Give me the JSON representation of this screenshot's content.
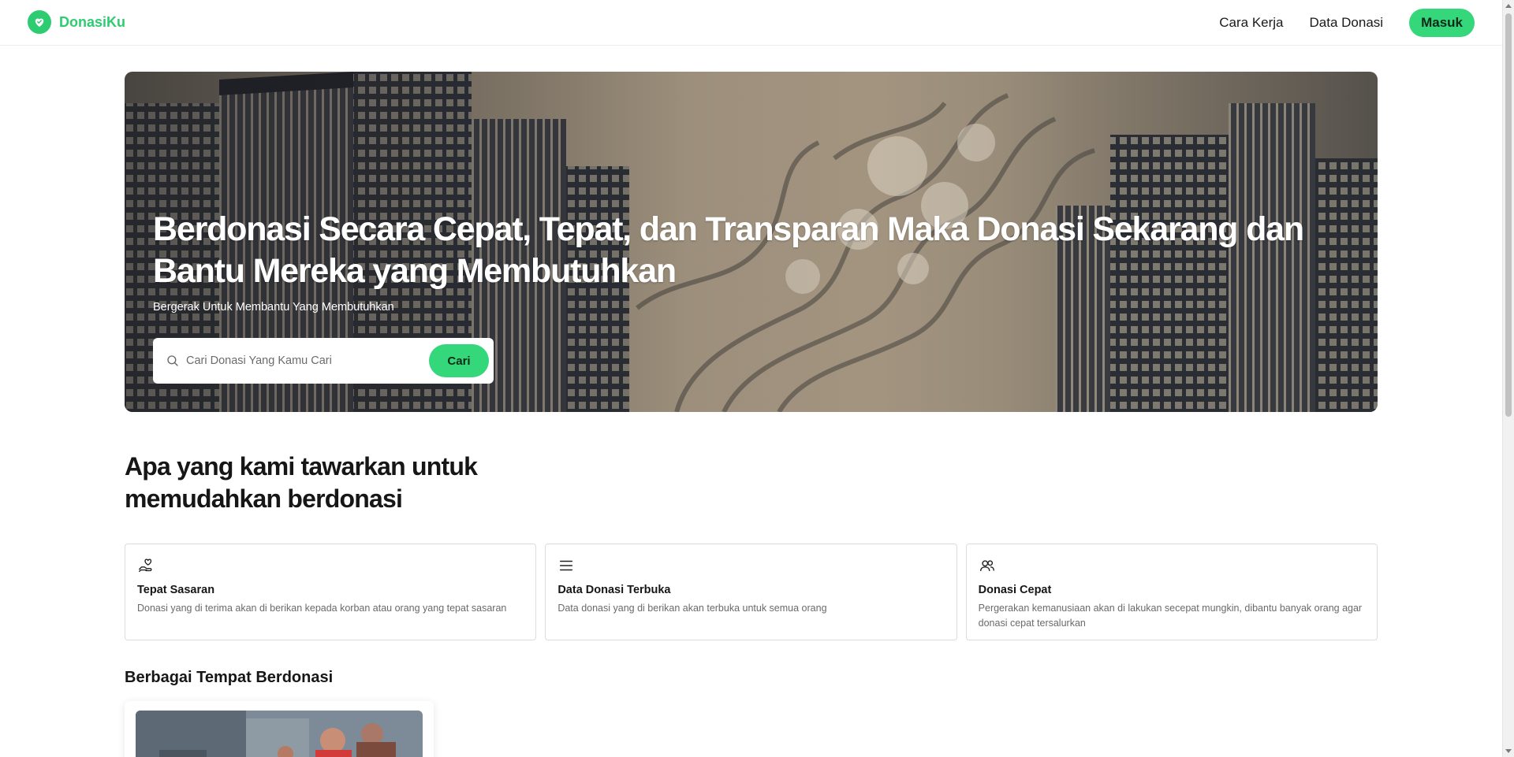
{
  "brand": {
    "name": "DonasiKu",
    "logo_icon": "heart-hand-icon",
    "color": "#2ecc71"
  },
  "nav": {
    "links": [
      "Cara Kerja",
      "Data Donasi"
    ],
    "login_label": "Masuk"
  },
  "hero": {
    "title": "Berdonasi Secara Cepat, Tepat, dan Transparan Maka Donasi Sekarang dan Bantu Mereka yang Membutuhkan",
    "subtitle": "Bergerak Untuk Membantu Yang Membutuhkan",
    "search": {
      "placeholder": "Cari Donasi Yang Kamu Cari",
      "value": "",
      "button_label": "Cari"
    }
  },
  "offers": {
    "heading": "Apa yang kami tawarkan untuk memudahkan berdonasi",
    "cards": [
      {
        "icon": "hand-heart-icon",
        "title": "Tepat Sasaran",
        "description": "Donasi yang di terima akan di berikan kepada korban atau orang yang tepat sasaran"
      },
      {
        "icon": "list-icon",
        "title": "Data Donasi Terbuka",
        "description": "Data donasi yang di berikan akan terbuka untuk semua orang"
      },
      {
        "icon": "users-icon",
        "title": "Donasi Cepat",
        "description": "Pergerakan kemanusiaan akan di lakukan secepat mungkin, dibantu banyak orang agar donasi cepat tersalurkan"
      }
    ]
  },
  "places": {
    "heading": "Berbagai Tempat Berdonasi"
  },
  "colors": {
    "accent": "#34d77a",
    "text": "#161616",
    "muted": "#6a6a6a"
  }
}
